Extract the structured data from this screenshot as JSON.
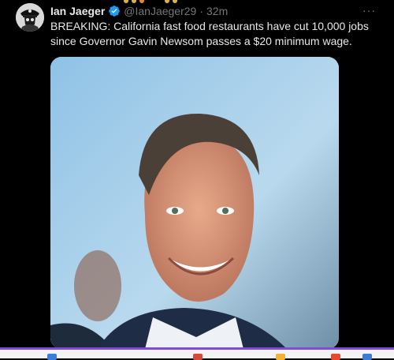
{
  "tweet": {
    "display_name": "Ian Jaeger",
    "handle": "@IanJaeger29",
    "separator": "·",
    "time": "32m",
    "more_label": "···",
    "text": "BREAKING: California fast food restaurants have cut 10,000 jobs since Governor Gavin Newsom passes a $20 minimum wage.",
    "verified_icon": "verified-badge-icon",
    "avatar_icon": "pirate-skull-avatar",
    "media_description_icon": "photo"
  },
  "colors": {
    "background": "#000000",
    "text_primary": "#e7e9ea",
    "text_secondary": "#71767b",
    "verified_blue": "#1d9bf0",
    "taskbar_accent": "#7d4bd8"
  }
}
